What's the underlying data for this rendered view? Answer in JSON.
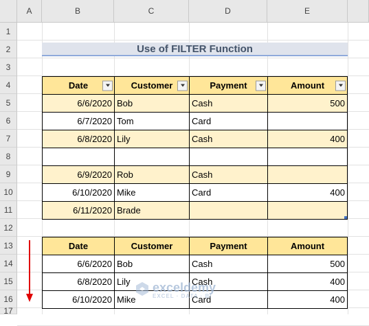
{
  "sheet": {
    "columns": [
      "A",
      "B",
      "C",
      "D",
      "E"
    ],
    "rows": [
      "1",
      "2",
      "3",
      "4",
      "5",
      "6",
      "7",
      "8",
      "9",
      "10",
      "11",
      "12",
      "13",
      "14",
      "15",
      "16",
      "17"
    ]
  },
  "title": "Use of FILTER Function",
  "source_table": {
    "headers": [
      "Date",
      "Customer",
      "Payment",
      "Amount"
    ],
    "rows": [
      [
        "6/6/2020",
        "Bob",
        "Cash",
        "500"
      ],
      [
        "6/7/2020",
        "Tom",
        "Card",
        ""
      ],
      [
        "6/8/2020",
        "Lily",
        "Cash",
        "400"
      ],
      [
        "",
        "",
        "",
        ""
      ],
      [
        "6/9/2020",
        "Rob",
        "Cash",
        ""
      ],
      [
        "6/10/2020",
        "Mike",
        "Card",
        "400"
      ],
      [
        "6/11/2020",
        "Brade",
        "",
        ""
      ]
    ]
  },
  "result_table": {
    "headers": [
      "Date",
      "Customer",
      "Payment",
      "Amount"
    ],
    "rows": [
      [
        "6/6/2020",
        "Bob",
        "Cash",
        "500"
      ],
      [
        "6/8/2020",
        "Lily",
        "Cash",
        "400"
      ],
      [
        "6/10/2020",
        "Mike",
        "Card",
        "400"
      ]
    ]
  },
  "watermark": {
    "name": "exceldemy",
    "tagline": "EXCEL · DATA · BI"
  },
  "colors": {
    "header_fill": "#ffe699",
    "band_fill": "#fff2cc",
    "title_fill": "#dfe3ec",
    "arrow": "#e00000"
  }
}
